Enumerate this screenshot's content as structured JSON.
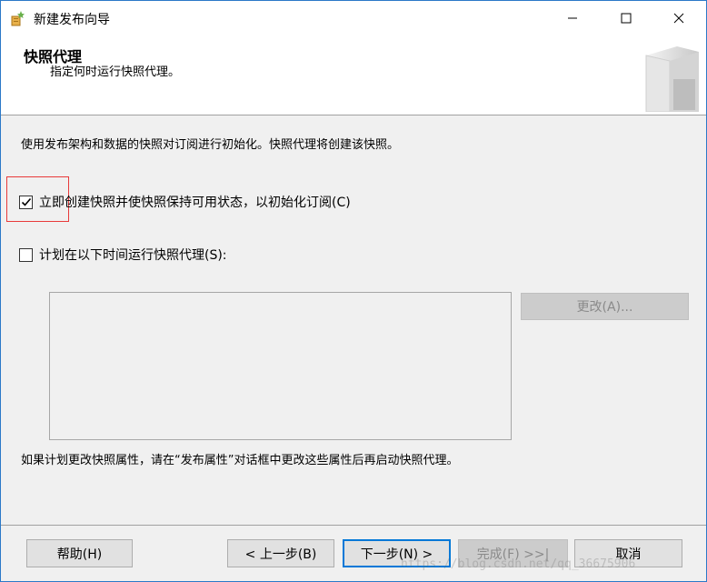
{
  "window": {
    "title": "新建发布向导",
    "icons": {
      "app": "wizard-app-icon",
      "minimize": "minimize-icon",
      "maximize": "maximize-icon",
      "close": "close-icon"
    }
  },
  "header": {
    "title": "快照代理",
    "subtitle": "指定何时运行快照代理。",
    "art_icon": "book-graphic-icon"
  },
  "body": {
    "description": "使用发布架构和数据的快照对订阅进行初始化。快照代理将创建该快照。",
    "create_snapshot": {
      "label": "立即创建快照并使快照保持可用状态，以初始化订阅(C)",
      "checked": true
    },
    "schedule_snapshot": {
      "label": "计划在以下时间运行快照代理(S):",
      "checked": false
    },
    "change_button": "更改(A)...",
    "note": "如果计划更改快照属性，请在“发布属性”对话框中更改这些属性后再启动快照代理。"
  },
  "footer": {
    "help": "帮助(H)",
    "prev": "< 上一步(B)",
    "next": "下一步(N) >",
    "finish": "完成(F) >>|",
    "cancel": "取消"
  },
  "watermark": "https://blog.csdn.net/qq_36675906",
  "colors": {
    "accent": "#0078d7",
    "highlight_box": "#e83a3a",
    "disabled_text": "#8a8a8a"
  }
}
